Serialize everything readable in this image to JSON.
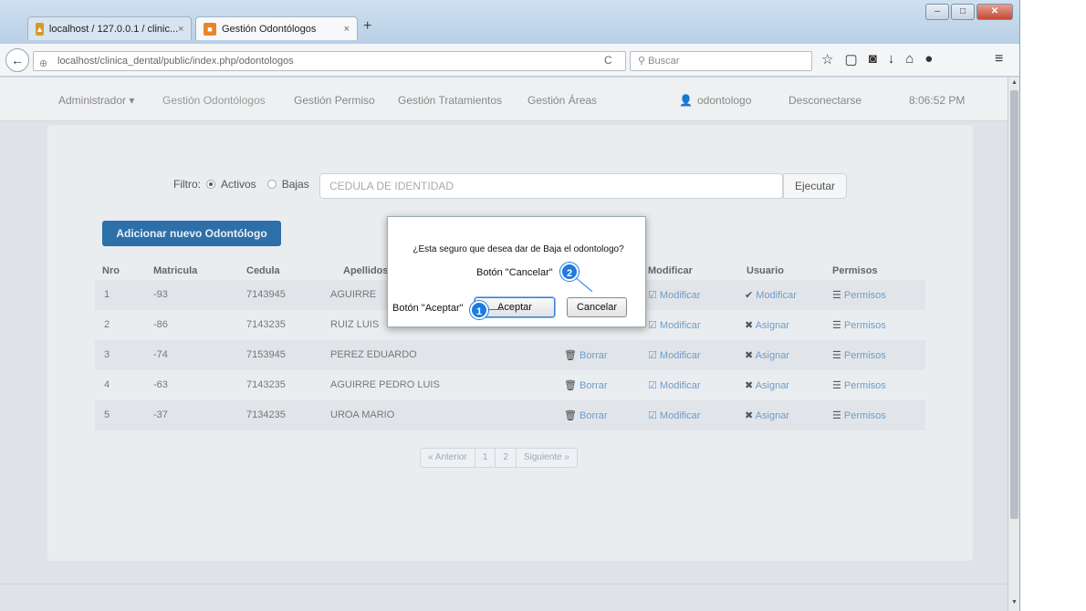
{
  "browser": {
    "tabs": [
      {
        "label": "localhost / 127.0.0.1 / clinic..."
      },
      {
        "label": "Gestión Odontólogos"
      }
    ],
    "url": "localhost/clinica_dental/public/index.php/odontologos",
    "search_placeholder": "Buscar",
    "new_tab": "+",
    "close_glyph": "×"
  },
  "appnav": {
    "items": [
      "Administrador ▾",
      "Gestión Odontólogos",
      "Gestión Permiso",
      "Gestión Tratamientos",
      "Gestión Áreas"
    ],
    "user": "odontologo",
    "logout": "Desconectarse",
    "time": "8:06:52 PM"
  },
  "filter": {
    "label": "Filtro:",
    "active": "Activos",
    "inactive": "Bajas",
    "placeholder": "CEDULA DE IDENTIDAD",
    "execute": "Ejecutar"
  },
  "add_button": "Adicionar nuevo Odontólogo",
  "table": {
    "headers": [
      "Nro",
      "Matricula",
      "Cedula",
      "Apellidos",
      "Modificar",
      "Usuario",
      "Permisos"
    ],
    "rows": [
      {
        "nro": "1",
        "matricula": "-93",
        "cedula": "7143945",
        "apellidos": "AGUIRRE",
        "borrar": "",
        "modificar": "Modificar",
        "usuario": "Modificar",
        "permisos": "Permisos"
      },
      {
        "nro": "2",
        "matricula": "-86",
        "cedula": "7143235",
        "apellidos": "RUIZ LUIS",
        "borrar": "",
        "modificar": "Modificar",
        "usuario": "Asignar",
        "permisos": "Permisos"
      },
      {
        "nro": "3",
        "matricula": "-74",
        "cedula": "7153945",
        "apellidos": "PEREZ EDUARDO",
        "borrar": "Borrar",
        "modificar": "Modificar",
        "usuario": "Asignar",
        "permisos": "Permisos"
      },
      {
        "nro": "4",
        "matricula": "-63",
        "cedula": "7143235",
        "apellidos": "AGUIRRE PEDRO LUIS",
        "borrar": "Borrar",
        "modificar": "Modificar",
        "usuario": "Asignar",
        "permisos": "Permisos"
      },
      {
        "nro": "5",
        "matricula": "-37",
        "cedula": "7134235",
        "apellidos": "UROA MARIO",
        "borrar": "Borrar",
        "modificar": "Modificar",
        "usuario": "Asignar",
        "permisos": "Permisos"
      }
    ]
  },
  "pager": {
    "prev": "« Anterior",
    "pages": [
      "1",
      "2"
    ],
    "next": "Siguiente »"
  },
  "dialog": {
    "message": "¿Esta seguro que desea dar de Baja el odontologo?",
    "accept": "Aceptar",
    "cancel": "Cancelar"
  },
  "callouts": {
    "accept_label": "Botón \"Aceptar\"",
    "accept_num": "1",
    "cancel_label": "Botón \"Cancelar\"",
    "cancel_num": "2"
  },
  "icons": {
    "back": "back-arrow-icon",
    "reload": "reload-icon",
    "search": "search-icon",
    "bookmark_star": "star-icon",
    "user": "user-icon",
    "trash": "trash-icon",
    "edit": "edit-icon",
    "check": "check-icon",
    "cross": "cross-icon",
    "permissions": "list-icon"
  },
  "colors": {
    "add_button_bg": "#2d6fa8",
    "link": "#6e9cc8",
    "callout": "#1e7be0"
  }
}
